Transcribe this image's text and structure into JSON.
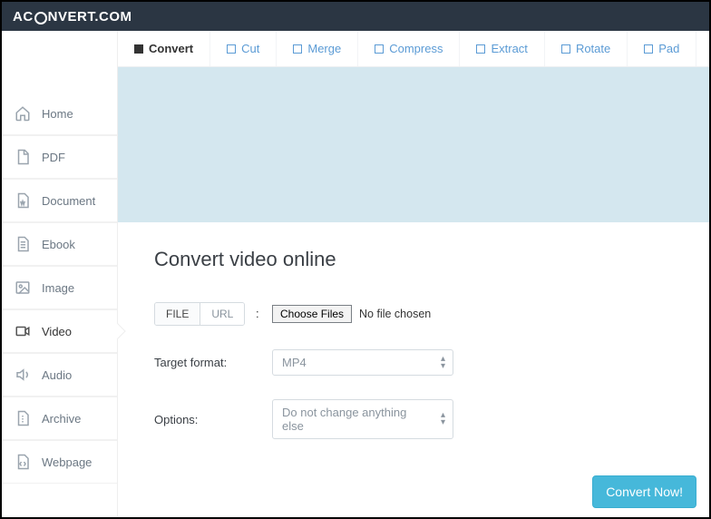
{
  "brand": {
    "pre": "AC",
    "post": "NVERT.COM"
  },
  "sidebar": {
    "items": [
      {
        "label": "Home",
        "icon": "home-icon"
      },
      {
        "label": "PDF",
        "icon": "pdf-icon"
      },
      {
        "label": "Document",
        "icon": "doc-icon"
      },
      {
        "label": "Ebook",
        "icon": "ebook-icon"
      },
      {
        "label": "Image",
        "icon": "image-icon"
      },
      {
        "label": "Video",
        "icon": "video-icon"
      },
      {
        "label": "Audio",
        "icon": "audio-icon"
      },
      {
        "label": "Archive",
        "icon": "archive-icon"
      },
      {
        "label": "Webpage",
        "icon": "webpage-icon"
      }
    ],
    "active_index": 5
  },
  "tabs": {
    "items": [
      "Convert",
      "Cut",
      "Merge",
      "Compress",
      "Extract",
      "Rotate",
      "Pad"
    ],
    "active_index": 0
  },
  "page": {
    "title": "Convert video online",
    "source_tabs": {
      "file": "FILE",
      "url": "URL",
      "selected": "file"
    },
    "colon": ":",
    "choose_files_btn": "Choose Files",
    "no_file_text": "No file chosen",
    "target_label": "Target format:",
    "target_value": "MP4",
    "options_label": "Options:",
    "options_value": "Do not change anything else",
    "convert_btn": "Convert Now!"
  }
}
